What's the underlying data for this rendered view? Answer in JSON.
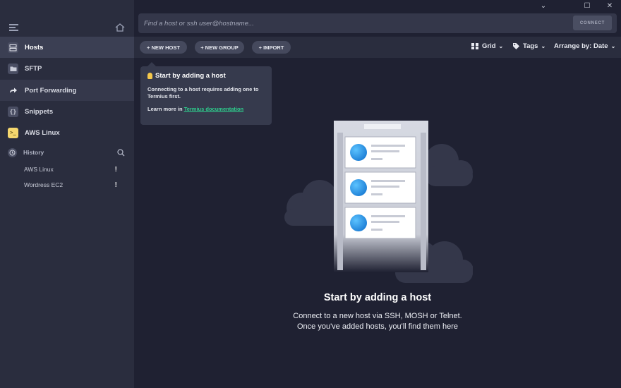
{
  "window": {
    "minimize": "⌄",
    "maximize": "☐",
    "close": "✕"
  },
  "search": {
    "placeholder": "Find a host or ssh user@hostname...",
    "connect_label": "CONNECT"
  },
  "sidebar": {
    "items": [
      {
        "label": "Hosts",
        "icon": "hosts-icon"
      },
      {
        "label": "SFTP",
        "icon": "folder-icon"
      },
      {
        "label": "Port Forwarding",
        "icon": "forward-arrow-icon"
      },
      {
        "label": "Snippets",
        "icon": "braces-icon"
      },
      {
        "label": "AWS Linux",
        "icon": "terminal-icon"
      }
    ],
    "history": {
      "label": "History",
      "entries": [
        {
          "label": "AWS Linux",
          "mark": "!"
        },
        {
          "label": "Wordress EC2",
          "mark": "!"
        }
      ]
    }
  },
  "toolbar": {
    "new_host": "+ NEW HOST",
    "new_group": "+ NEW GROUP",
    "import": "+ IMPORT",
    "view": "Grid",
    "tags": "Tags",
    "arrange": "Arrange by: Date"
  },
  "tooltip": {
    "title": "Start by adding a host",
    "body": "Connecting to a host requires adding one to Termius first.",
    "learn_prefix": "Learn more in ",
    "learn_link": "Termius documentation"
  },
  "empty_state": {
    "title": "Start by adding a host",
    "line1": "Connect to a new host via SSH, MOSH or Telnet.",
    "line2": "Once you've added hosts, you'll find them here"
  },
  "colors": {
    "accent_link": "#2ecf8e",
    "sidebar_bg": "#2a2d3e",
    "main_bg": "#1f2132",
    "aws_icon": "#f5d76e"
  }
}
